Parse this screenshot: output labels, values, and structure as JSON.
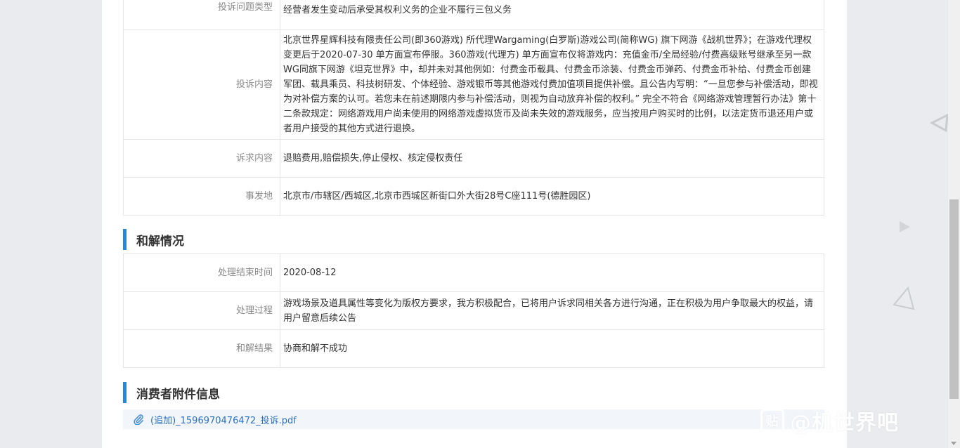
{
  "complaint_details": {
    "rows": [
      {
        "label": "投诉问题类型",
        "value": "经营者发生变动后承受其权利义务的企业不履行三包义务"
      },
      {
        "label": "投诉内容",
        "value": "北京世界星辉科技有限责任公司(即360游戏) 所代理Wargaming(白罗斯)游戏公司(简称WG) 旗下网游《战机世界》；在游戏代理权变更后于2020-07-30 单方面宣布停服。360游戏(代理方) 单方面宣布仅将游戏内：充值金币/全局经验/付费高级账号继承至另一款WG同旗下网游《坦克世界》中，却并未对其他例如：付费金币载具、付费金币涂装、付费金币弹药、付费金币补给、付费金币创建军团、载具乘员、科技树研发、个体经验、游戏银币等其他游戏付费加值项目提供补偿。且公告内写明：“一旦您参与补偿活动，即视为对补偿方案的认可。若您未在前述期限内参与补偿活动，则视为自动放弃补偿的权利。” 完全不符合《网络游戏管理暂行办法》第十二条款规定：网络游戏用户尚未使用的网络游戏虚拟货币及尚未失效的游戏服务，应当按用户购买时的比例，以法定货币退还用户或者用户接受的其他方式进行退换。"
      },
      {
        "label": "诉求内容",
        "value": "退赔费用,赔偿损失,停止侵权、核定侵权责任"
      },
      {
        "label": "事发地",
        "value": "北京市/市辖区/西城区,北京市西城区新街口外大街28号C座111号(德胜园区)"
      }
    ]
  },
  "settlement": {
    "title": "和解情况",
    "rows": [
      {
        "label": "处理结束时间",
        "value": "2020-08-12"
      },
      {
        "label": "处理过程",
        "value": "游戏场景及道具属性等变化为版权方要求，我方积极配合，已将用户诉求同相关各方进行沟通，正在积极为用户争取最大的权益，请用户留意后续公告"
      },
      {
        "label": "和解结果",
        "value": "协商和解不成功"
      }
    ]
  },
  "attachments": {
    "title": "消费者附件信息",
    "file_name": "(追加)_1596970476472_投诉.pdf",
    "icon": "paperclip-icon"
  },
  "watermark": {
    "logo_text": "贴",
    "text": "@机世界吧"
  },
  "colors": {
    "accent": "#2a86d7",
    "link": "#2a6fc2",
    "label": "#8a8a8a",
    "border": "#e5e5e5"
  }
}
